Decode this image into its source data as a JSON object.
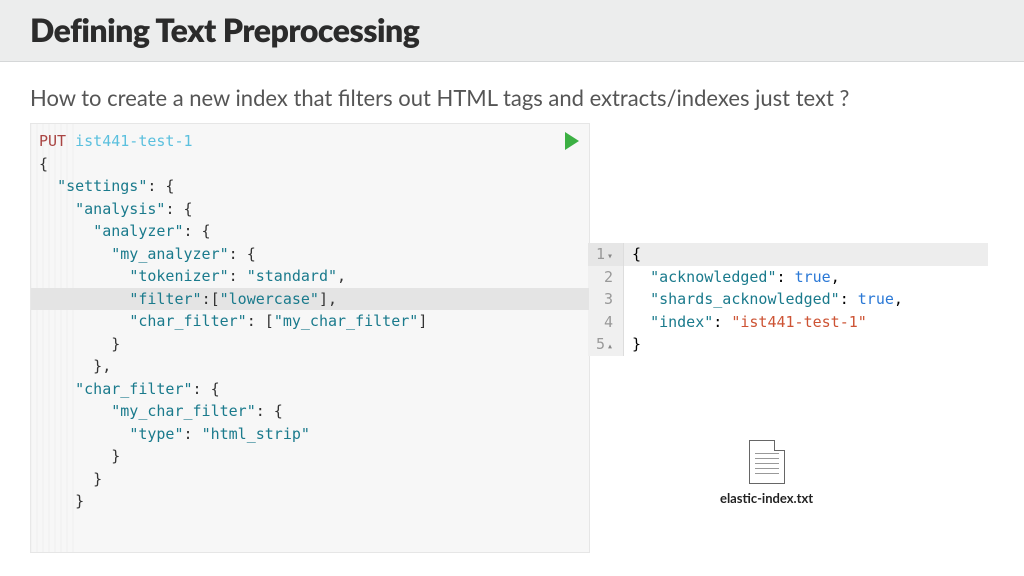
{
  "header": {
    "title": "Defining Text Preprocessing"
  },
  "subtitle": "How to create a new index that filters out HTML tags and extracts/indexes just text ?",
  "request": {
    "method": "PUT",
    "uri": "ist441-test-1",
    "body_lines": [
      {
        "text": "{"
      },
      {
        "indent": 1,
        "key": "\"settings\"",
        "after": ": {"
      },
      {
        "indent": 2,
        "key": "\"analysis\"",
        "after": ": {"
      },
      {
        "indent": 3,
        "key": "\"analyzer\"",
        "after": ": {"
      },
      {
        "indent": 4,
        "key": "\"my_analyzer\"",
        "after": ": {"
      },
      {
        "indent": 5,
        "key": "\"tokenizer\"",
        "after": ": ",
        "val": "\"standard\"",
        "tail": ","
      },
      {
        "indent": 5,
        "key": "\"filter\"",
        "after": ":[",
        "val": "\"lowercase\"",
        "tail": "],",
        "hl": true
      },
      {
        "indent": 5,
        "key": "\"char_filter\"",
        "after": ": [",
        "val": "\"my_char_filter\"",
        "tail": "]"
      },
      {
        "indent": 4,
        "text": "}"
      },
      {
        "text": ""
      },
      {
        "indent": 3,
        "text": "},"
      },
      {
        "text": ""
      },
      {
        "indent": 2,
        "key": "\"char_filter\"",
        "after": ": {"
      },
      {
        "indent": 4,
        "key": "\"my_char_filter\"",
        "after": ": {"
      },
      {
        "indent": 5,
        "key": "\"type\"",
        "after": ": ",
        "val": "\"html_strip\""
      },
      {
        "indent": 4,
        "text": "}"
      },
      {
        "indent": 3,
        "text": "}"
      },
      {
        "text": ""
      },
      {
        "indent": 2,
        "text": "}"
      }
    ]
  },
  "response": {
    "rows": [
      {
        "n": "1",
        "fold": "▾",
        "code": "{",
        "hl": true
      },
      {
        "n": "2",
        "key": "\"acknowledged\"",
        "val": "true",
        "comma": true,
        "isBool": true
      },
      {
        "n": "3",
        "key": "\"shards_acknowledged\"",
        "val": "true",
        "comma": true,
        "isBool": true
      },
      {
        "n": "4",
        "key": "\"index\"",
        "val": "\"ist441-test-1\"",
        "comma": false,
        "isBool": false
      },
      {
        "n": "5",
        "fold": "▴",
        "code": "}"
      }
    ]
  },
  "file": {
    "name": "elastic-index.txt"
  }
}
